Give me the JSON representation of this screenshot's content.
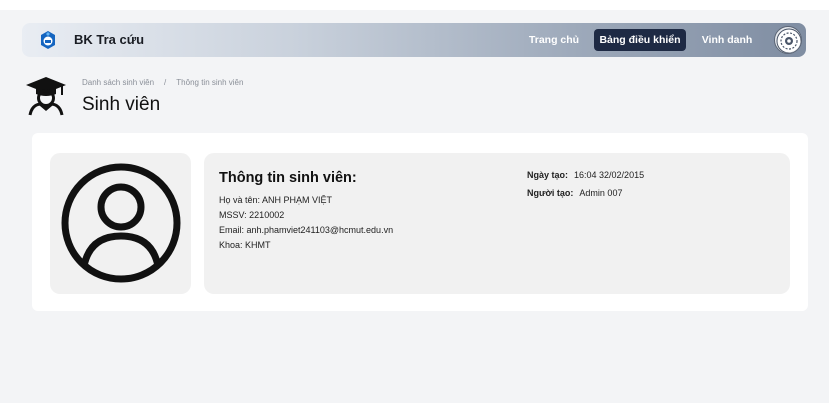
{
  "nav": {
    "brand": "BK Tra cứu",
    "links": [
      {
        "label": "Trang chủ",
        "active": false
      },
      {
        "label": "Bảng điều khiển",
        "active": true
      },
      {
        "label": "Vinh danh",
        "active": false
      }
    ],
    "logo_icon": "bk-logo-icon",
    "avatar_icon": "user-avatar-icon"
  },
  "header": {
    "icon": "graduate-student-icon",
    "breadcrumb": [
      "Danh sách sinh viên",
      "/",
      "Thông tin sinh viên"
    ],
    "title": "Sinh viên"
  },
  "student": {
    "avatar_icon": "user-circle-icon",
    "section_title": "Thông tin sinh viên:",
    "name_line": "Họ và tên: ANH PHẠM VIỆT",
    "mssv_line": "MSSV: 2210002",
    "email_line": "Email: anh.phamviet241103@hcmut.edu.vn",
    "faculty_line": "Khoa: KHMT"
  },
  "meta": {
    "created_label": "Ngày tạo:",
    "created_value": "16:04 32/02/2015",
    "creator_label": "Người tạo:",
    "creator_value": "Admin 007"
  },
  "colors": {
    "active_nav_bg": "#1e2a44",
    "panel_bg": "#f1f1f1",
    "page_bg": "#f3f4f6"
  }
}
